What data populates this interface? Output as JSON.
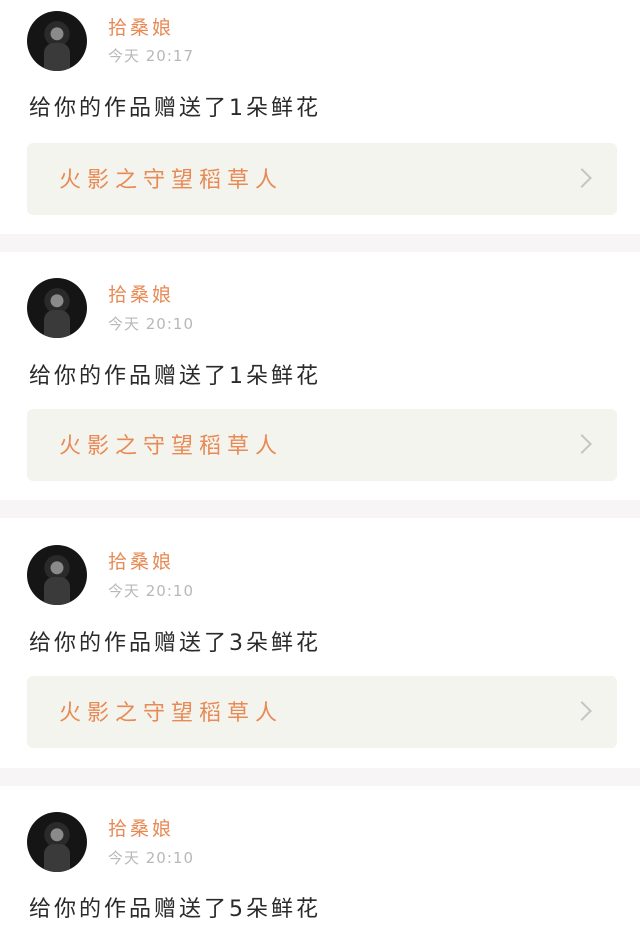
{
  "notifications": [
    {
      "user": "拾桑娘",
      "time": "今天 20:17",
      "message": "给你的作品赠送了1朵鲜花",
      "work_title": "火影之守望稻草人"
    },
    {
      "user": "拾桑娘",
      "time": "今天 20:10",
      "message": "给你的作品赠送了1朵鲜花",
      "work_title": "火影之守望稻草人"
    },
    {
      "user": "拾桑娘",
      "time": "今天 20:10",
      "message": "给你的作品赠送了3朵鲜花",
      "work_title": "火影之守望稻草人"
    },
    {
      "user": "拾桑娘",
      "time": "今天 20:10",
      "message": "给你的作品赠送了5朵鲜花"
    }
  ],
  "colors": {
    "accent": "#e88a55",
    "muted": "#b8b8b8",
    "card_bg": "#f4f4ee",
    "separator": "#f7f5f5"
  }
}
